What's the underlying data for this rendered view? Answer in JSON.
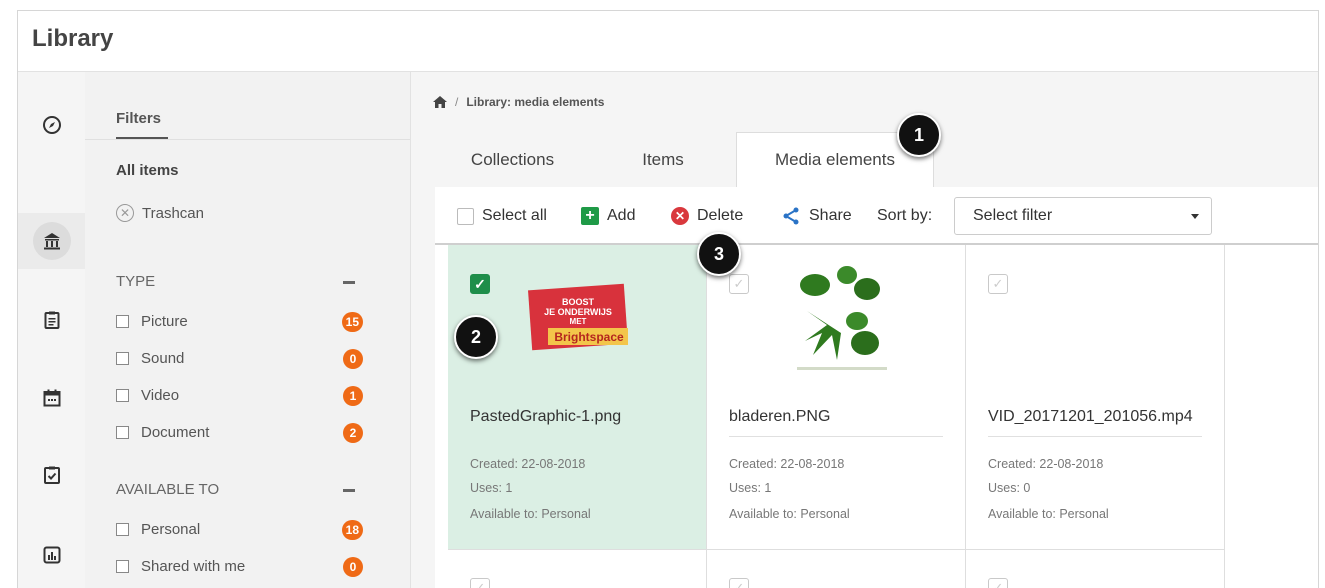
{
  "app": {
    "title": "Library"
  },
  "rail": {
    "items": [
      "compass-icon",
      "library-icon",
      "clipboard-icon",
      "calendar-icon",
      "checklist-icon",
      "chart-icon"
    ],
    "active": 1
  },
  "filters": {
    "heading": "Filters",
    "all_items": "All items",
    "trashcan": "Trashcan",
    "type": {
      "title": "TYPE",
      "items": [
        {
          "label": "Picture",
          "count": "15"
        },
        {
          "label": "Sound",
          "count": "0"
        },
        {
          "label": "Video",
          "count": "1"
        },
        {
          "label": "Document",
          "count": "2"
        }
      ]
    },
    "available_to": {
      "title": "AVAILABLE TO",
      "items": [
        {
          "label": "Personal",
          "count": "18"
        },
        {
          "label": "Shared with me",
          "count": "0"
        }
      ]
    }
  },
  "breadcrumb": {
    "separator": "/",
    "current": "Library: media elements"
  },
  "tabs": [
    {
      "label": "Collections",
      "active": false
    },
    {
      "label": "Items",
      "active": false
    },
    {
      "label": "Media elements",
      "active": true
    }
  ],
  "toolbar": {
    "select_all": "Select all",
    "add": "Add",
    "delete": "Delete",
    "share": "Share",
    "sort_by": "Sort by:",
    "sort_value": "Select filter"
  },
  "cards": [
    {
      "filename": "PastedGraphic-1.png",
      "created": "Created:  22-08-2018",
      "uses": "Uses:  1",
      "available": "Available to:  Personal",
      "selected": true,
      "thumb_text": [
        "BOOST",
        "JE ONDERWIJS",
        "MET",
        "Brightspace"
      ]
    },
    {
      "filename": "bladeren.PNG",
      "created": "Created:  22-08-2018",
      "uses": "Uses:  1",
      "available": "Available to:  Personal",
      "selected": false
    },
    {
      "filename": "VID_20171201_201056.mp4",
      "created": "Created:  22-08-2018",
      "uses": "Uses:  0",
      "available": "Available to:  Personal",
      "selected": false
    }
  ],
  "callouts": [
    "1",
    "2",
    "3"
  ],
  "colors": {
    "accent_green": "#1e8e4a",
    "badge_orange": "#ef6a16",
    "delete_red": "#d9383d",
    "share_blue": "#2a73c6",
    "selected_bg": "#dbefe4"
  }
}
